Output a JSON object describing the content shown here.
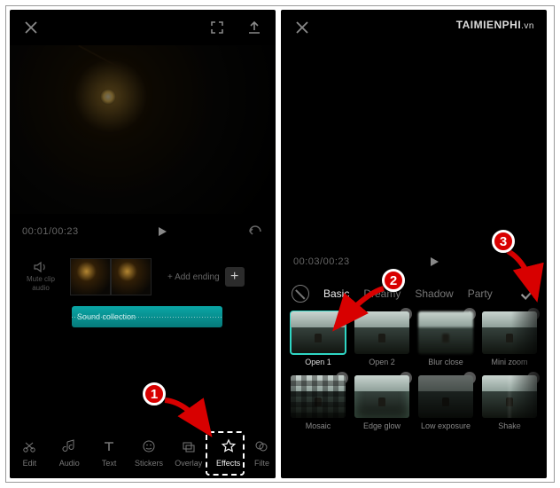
{
  "watermark": {
    "brand": "TAIMIENPHI",
    "suffix": ".vn"
  },
  "dashed_highlight_target": "effects-tool",
  "left": {
    "time_current": "00:01",
    "time_total": "00:23",
    "mute_label": "Mute clip audio",
    "add_ending_label": "+ Add ending",
    "audio_clip_label": "Sound collection",
    "toolbar": [
      {
        "id": "edit",
        "label": "Edit"
      },
      {
        "id": "audio",
        "label": "Audio"
      },
      {
        "id": "text",
        "label": "Text"
      },
      {
        "id": "stickers",
        "label": "Stickers"
      },
      {
        "id": "overlay",
        "label": "Overlay"
      },
      {
        "id": "effects",
        "label": "Effects",
        "active": true
      },
      {
        "id": "filters",
        "label": "Filte"
      }
    ]
  },
  "right": {
    "time_current": "00:03",
    "time_total": "00:23",
    "categories": [
      {
        "id": "basic",
        "label": "Basic",
        "active": true
      },
      {
        "id": "dreamy",
        "label": "Dreamy"
      },
      {
        "id": "shadow",
        "label": "Shadow"
      },
      {
        "id": "party",
        "label": "Party"
      }
    ],
    "effects": [
      {
        "id": "open1",
        "label": "Open 1",
        "selected": true
      },
      {
        "id": "open2",
        "label": "Open 2"
      },
      {
        "id": "blurclose",
        "label": "Blur close"
      },
      {
        "id": "minizoom",
        "label": "Mini zoom"
      },
      {
        "id": "mosaic",
        "label": "Mosaic"
      },
      {
        "id": "edgeglow",
        "label": "Edge glow"
      },
      {
        "id": "lowexp",
        "label": "Low exposure"
      },
      {
        "id": "shake",
        "label": "Shake"
      }
    ]
  },
  "annotations": [
    {
      "n": "1",
      "points_to": "effects-tool"
    },
    {
      "n": "2",
      "points_to": "effect-open1"
    },
    {
      "n": "3",
      "points_to": "confirm-check"
    }
  ]
}
